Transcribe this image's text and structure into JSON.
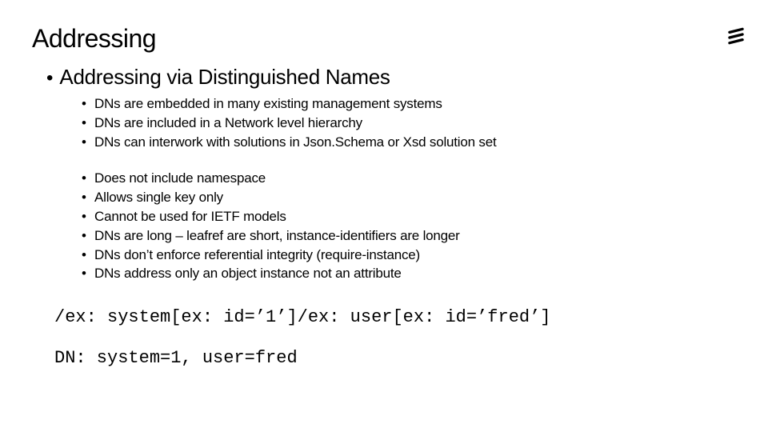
{
  "title": "Addressing",
  "subtitle": "Addressing via Distinguished Names",
  "bullets_a": [
    "DNs are embedded in many existing management systems",
    "DNs are included in a Network level hierarchy",
    "DNs can interwork with solutions in Json.Schema or Xsd solution set"
  ],
  "bullets_b": [
    "Does not include namespace",
    "Allows single key only",
    "Cannot be used for IETF models",
    "DNs are long – leafref are short, instance-identifiers are longer",
    "DNs don’t enforce referential integrity (require-instance)",
    "DNs address only an object instance not an attribute"
  ],
  "code_line1": "/ex: system[ex: id=’1’]/ex: user[ex: id=’fred’]",
  "code_line2": "DN: system=1, user=fred",
  "logo_name": "ericsson-logo"
}
